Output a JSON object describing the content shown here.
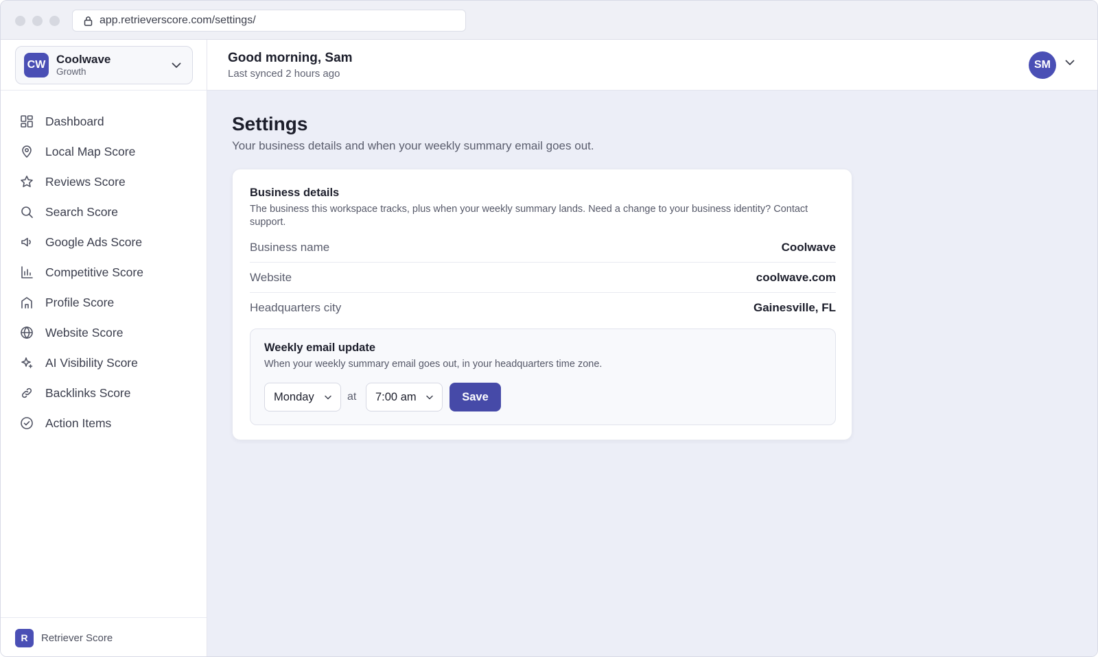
{
  "browser": {
    "url": "app.retrieverscore.com/settings/"
  },
  "workspace": {
    "initials": "CW",
    "name": "Coolwave",
    "plan": "Growth"
  },
  "sidebar": {
    "items": [
      {
        "label": "Dashboard",
        "icon": "dashboard-icon"
      },
      {
        "label": "Local Map Score",
        "icon": "map-pin-icon"
      },
      {
        "label": "Reviews Score",
        "icon": "star-icon"
      },
      {
        "label": "Search Score",
        "icon": "search-icon"
      },
      {
        "label": "Google Ads Score",
        "icon": "megaphone-icon"
      },
      {
        "label": "Competitive Score",
        "icon": "bar-chart-icon"
      },
      {
        "label": "Profile Score",
        "icon": "storefront-icon"
      },
      {
        "label": "Website Score",
        "icon": "globe-icon"
      },
      {
        "label": "AI Visibility Score",
        "icon": "sparkle-icon"
      },
      {
        "label": "Backlinks Score",
        "icon": "link-icon"
      },
      {
        "label": "Action Items",
        "icon": "check-circle-icon"
      }
    ],
    "footer": {
      "logo_letter": "R",
      "label": "Retriever Score"
    }
  },
  "header": {
    "greeting": "Good morning, Sam",
    "synced": "Last synced 2 hours ago",
    "avatar_initials": "SM"
  },
  "page": {
    "title": "Settings",
    "subtitle": "Your business details and when your weekly summary email goes out."
  },
  "business_details": {
    "title": "Business details",
    "description": "The business this workspace tracks, plus when your weekly summary lands. Need a change to your business identity? Contact support.",
    "rows": [
      {
        "label": "Business name",
        "value": "Coolwave"
      },
      {
        "label": "Website",
        "value": "coolwave.com"
      },
      {
        "label": "Headquarters city",
        "value": "Gainesville, FL"
      }
    ]
  },
  "weekly_email": {
    "title": "Weekly email update",
    "description": "When your weekly summary email goes out, in your headquarters time zone.",
    "day": "Monday",
    "at_label": "at",
    "time": "7:00 am",
    "save_label": "Save"
  },
  "colors": {
    "accent": "#4a4fb5",
    "main_bg": "#eceef7"
  }
}
